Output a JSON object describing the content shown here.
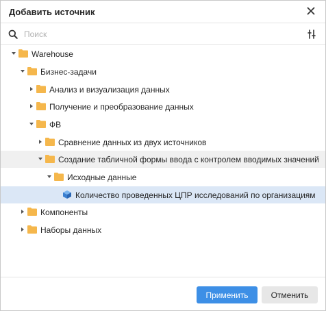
{
  "dialog": {
    "title": "Добавить источник"
  },
  "search": {
    "placeholder": "Поиск",
    "value": ""
  },
  "colors": {
    "folder": "#f5b74c",
    "cube": "#4a90d9",
    "selected_row": "#dbe7f6",
    "hover_row": "#f0f0f0",
    "apply_button": "#3d8fe6"
  },
  "tree": {
    "items": [
      {
        "label": "Warehouse",
        "type": "folder",
        "expanded": true
      },
      {
        "label": "Бизнес-задачи",
        "type": "folder",
        "expanded": true
      },
      {
        "label": "Анализ и визуализация данных",
        "type": "folder",
        "expanded": false
      },
      {
        "label": "Получение и преобразование данных",
        "type": "folder",
        "expanded": false
      },
      {
        "label": "ФВ",
        "type": "folder",
        "expanded": true
      },
      {
        "label": "Сравнение данных из двух источников",
        "type": "folder",
        "expanded": false
      },
      {
        "label": "Создание табличной формы ввода с контролем вводимых значений",
        "type": "folder",
        "expanded": true
      },
      {
        "label": "Исходные данные",
        "type": "folder",
        "expanded": true
      },
      {
        "label": "Количество проведенных ЦПР исследований по организациям",
        "type": "cube",
        "selected": true
      },
      {
        "label": "Компоненты",
        "type": "folder",
        "expanded": false
      },
      {
        "label": "Наборы данных",
        "type": "folder",
        "expanded": false
      }
    ]
  },
  "footer": {
    "apply_label": "Применить",
    "cancel_label": "Отменить"
  }
}
